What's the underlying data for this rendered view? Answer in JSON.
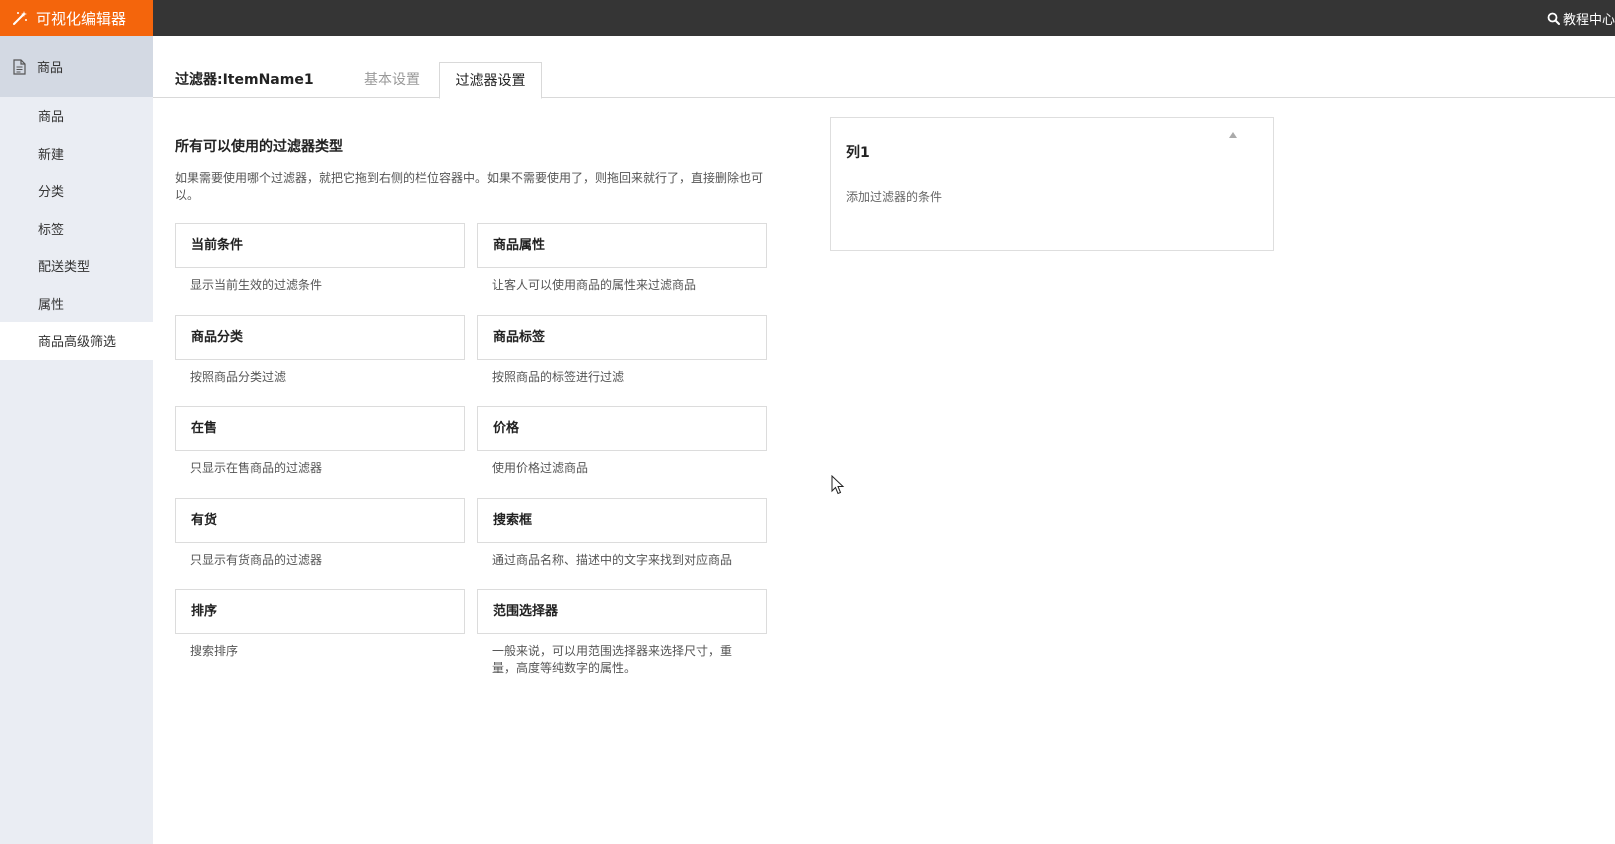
{
  "header": {
    "brand": "可视化编辑器",
    "help_link": "教程中心"
  },
  "sidebar": {
    "section": "商品",
    "items": [
      {
        "label": "商品"
      },
      {
        "label": "新建"
      },
      {
        "label": "分类"
      },
      {
        "label": "标签"
      },
      {
        "label": "配送类型"
      },
      {
        "label": "属性"
      },
      {
        "label": "商品高级筛选"
      }
    ]
  },
  "tabs": {
    "title": "过滤器:ItemName1",
    "basic": "基本设置",
    "filter": "过滤器设置"
  },
  "available": {
    "title": "所有可以使用的过滤器类型",
    "description": "如果需要使用哪个过滤器，就把它拖到右侧的栏位容器中。如果不需要使用了，则拖回来就行了，直接删除也可以。",
    "filters": [
      {
        "name": "当前条件",
        "desc": "显示当前生效的过滤条件"
      },
      {
        "name": "商品属性",
        "desc": "让客人可以使用商品的属性来过滤商品"
      },
      {
        "name": "商品分类",
        "desc": "按照商品分类过滤"
      },
      {
        "name": "商品标签",
        "desc": "按照商品的标签进行过滤"
      },
      {
        "name": "在售",
        "desc": "只显示在售商品的过滤器"
      },
      {
        "name": "价格",
        "desc": "使用价格过滤商品"
      },
      {
        "name": "有货",
        "desc": "只显示有货商品的过滤器"
      },
      {
        "name": "搜索框",
        "desc": "通过商品名称、描述中的文字来找到对应商品"
      },
      {
        "name": "排序",
        "desc": "搜索排序"
      },
      {
        "name": "范围选择器",
        "desc": "一般来说，可以用范围选择器来选择尺寸，重量，高度等纯数字的属性。"
      }
    ]
  },
  "column": {
    "title": "列1",
    "hint": "添加过滤器的条件"
  },
  "colors": {
    "brand": "#f4650c",
    "topbar": "#353535",
    "sidebar": "#eaedf3"
  }
}
